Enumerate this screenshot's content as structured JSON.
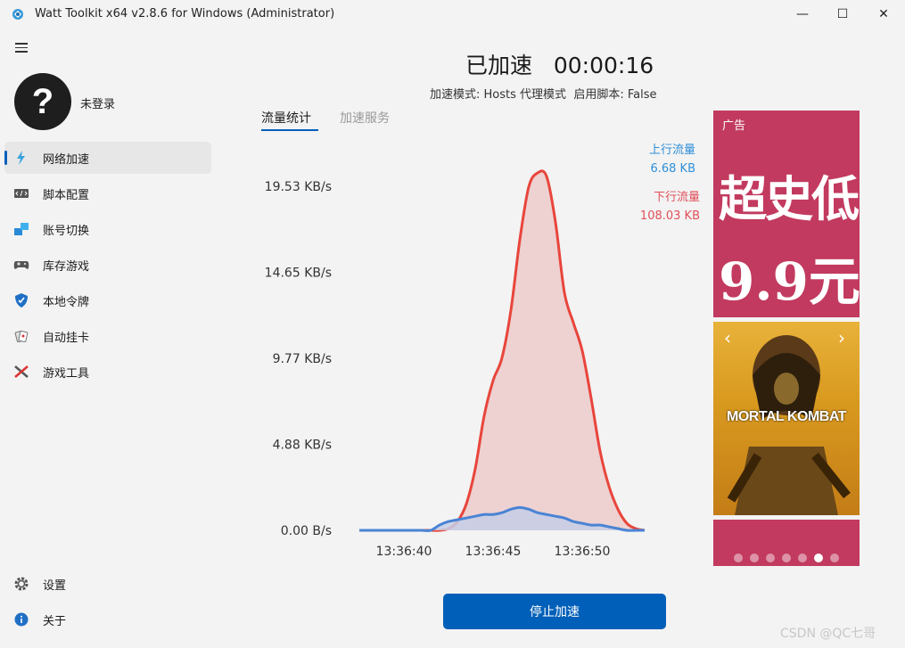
{
  "window": {
    "title": "Watt Toolkit x64 v2.8.6 for Windows (Administrator)",
    "minimize_glyph": "—",
    "maximize_glyph": "☐",
    "close_glyph": "✕"
  },
  "user": {
    "avatar_glyph": "?",
    "login_status": "未登录"
  },
  "sidebar": {
    "items": [
      {
        "label": "网络加速",
        "icon": "lightning-icon",
        "active": true
      },
      {
        "label": "脚本配置",
        "icon": "script-icon"
      },
      {
        "label": "账号切换",
        "icon": "account-switch-icon"
      },
      {
        "label": "库存游戏",
        "icon": "gamepad-icon"
      },
      {
        "label": "本地令牌",
        "icon": "shield-icon"
      },
      {
        "label": "自动挂卡",
        "icon": "cards-icon"
      },
      {
        "label": "游戏工具",
        "icon": "tools-icon"
      }
    ],
    "bottom": [
      {
        "label": "设置",
        "icon": "gear-icon"
      },
      {
        "label": "关于",
        "icon": "info-icon"
      }
    ]
  },
  "status": {
    "title": "已加速",
    "timer": "00:00:16",
    "mode_label": "加速模式:",
    "mode_value": "Hosts 代理模式",
    "script_label": "启用脚本:",
    "script_value": "False"
  },
  "tabs": [
    {
      "label": "流量统计",
      "active": true
    },
    {
      "label": "加速服务",
      "active": false
    }
  ],
  "legend": {
    "upload_label": "上行流量",
    "upload_value": "6.68 KB",
    "upload_color": "#2f8fd8",
    "download_label": "下行流量",
    "download_value": "108.03 KB",
    "download_color": "#e0505a"
  },
  "chart_data": {
    "type": "area",
    "yticks": [
      "0.00 B/s",
      "4.88 KB/s",
      "9.77 KB/s",
      "14.65 KB/s",
      "19.53 KB/s"
    ],
    "ylim": [
      0,
      20.5
    ],
    "xticks": [
      "13:36:40",
      "13:36:45",
      "13:36:50"
    ],
    "x": [
      0,
      1,
      2,
      3,
      4,
      5,
      6,
      7,
      8,
      9,
      10,
      11,
      12,
      13,
      14,
      15,
      16,
      17,
      18,
      19,
      20,
      21,
      22,
      23,
      24,
      25,
      26,
      27,
      28,
      29,
      30,
      31,
      32
    ],
    "series": [
      {
        "name": "下行流量",
        "color": "#e8453c",
        "fill": "#eccaca",
        "values": [
          0,
          0,
          0,
          0,
          0,
          0,
          0,
          0,
          0,
          0,
          0.1,
          0.5,
          1.5,
          3.5,
          6.5,
          8.5,
          9.8,
          12.5,
          16.5,
          19.5,
          20.3,
          20.1,
          17.5,
          13.5,
          11.8,
          10.2,
          7.5,
          4.5,
          2.5,
          1.2,
          0.4,
          0.1,
          0
        ]
      },
      {
        "name": "上行流量",
        "color": "#4a84d4",
        "fill": "#c6cfe8",
        "values": [
          0,
          0,
          0,
          0,
          0,
          0,
          0,
          0,
          0,
          0.3,
          0.5,
          0.6,
          0.7,
          0.8,
          0.9,
          0.9,
          1.0,
          1.2,
          1.3,
          1.2,
          1.0,
          0.9,
          0.8,
          0.7,
          0.5,
          0.4,
          0.3,
          0.3,
          0.2,
          0.1,
          0,
          0,
          0
        ]
      }
    ]
  },
  "ad": {
    "label": "广告",
    "line1": "超史低",
    "line2": "9.9元",
    "game_title": "MORTAL KOMBAT",
    "prev_glyph": "‹",
    "next_glyph": "›",
    "dot_count": 7,
    "active_dot": 5
  },
  "actions": {
    "stop_label": "停止加速"
  },
  "watermark": "CSDN @QC七哥"
}
